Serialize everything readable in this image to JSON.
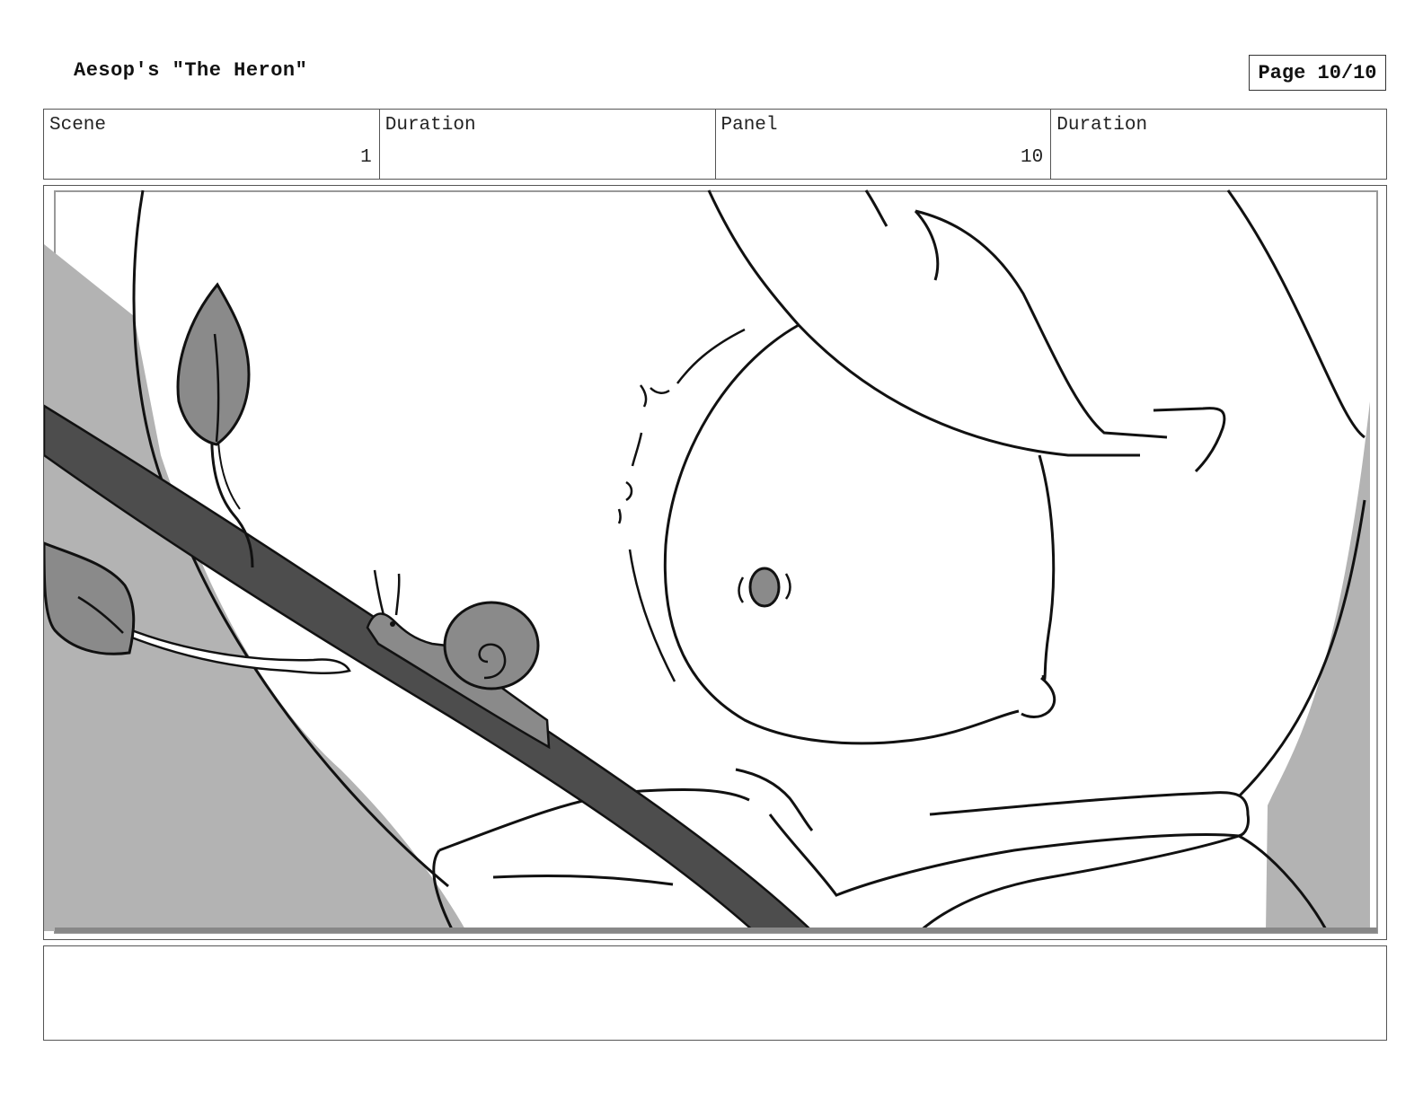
{
  "header": {
    "title": "Aesop's \"The Heron\"",
    "page": "Page 10/10"
  },
  "info_row": {
    "scene_label": "Scene",
    "scene_value": "1",
    "scene_duration_label": "Duration",
    "panel_label": "Panel",
    "panel_value": "10",
    "panel_duration_label": "Duration"
  },
  "colors": {
    "ink": "#111111",
    "light_gray": "#b3b3b3",
    "mid_gray": "#8a8a8a",
    "dark_gray": "#4d4d4d"
  }
}
